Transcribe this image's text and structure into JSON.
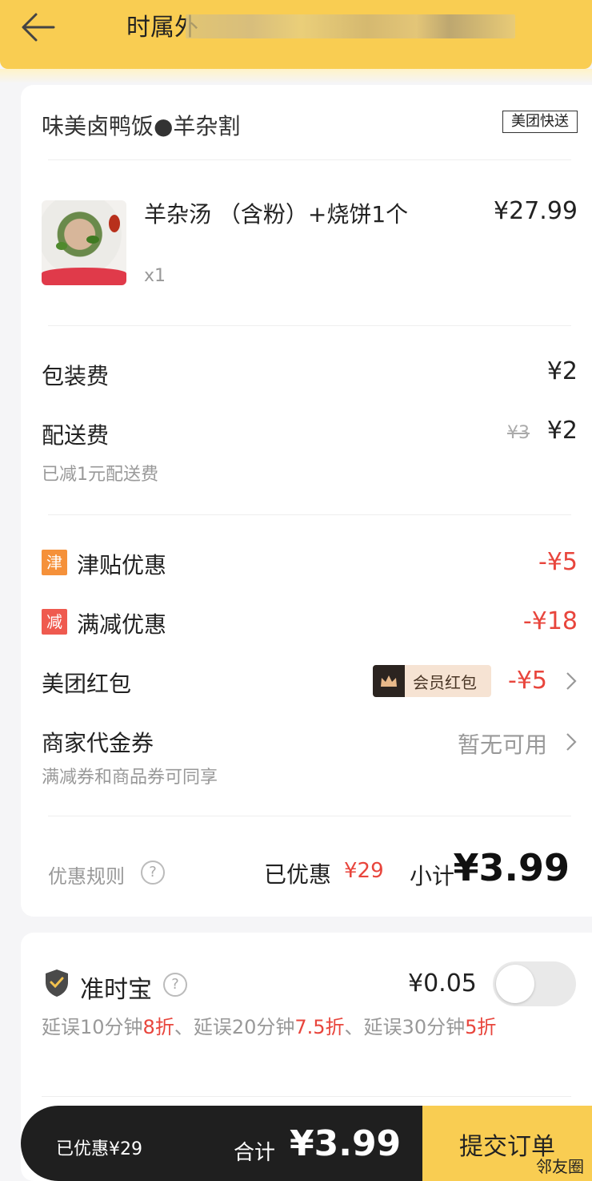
{
  "header": {
    "title": "时属外"
  },
  "order": {
    "shop_name": "味美卤鸭饭●羊杂割",
    "delivery_tag": "美团快送",
    "product": {
      "name": "羊杂汤 （含粉）+烧饼1个",
      "qty": "x1",
      "price": "¥27.99"
    },
    "packing": {
      "label": "包装费",
      "value": "¥2"
    },
    "delivery": {
      "label": "配送费",
      "original": "¥3",
      "value": "¥2",
      "note": "已减1元配送费"
    },
    "subsidy": {
      "badge": "津",
      "label": "津贴优惠",
      "value": "-¥5"
    },
    "discount": {
      "badge": "减",
      "label": "满减优惠",
      "value": "-¥18"
    },
    "redpacket": {
      "label": "美团红包",
      "tag": "会员红包",
      "value": "-¥5"
    },
    "voucher": {
      "label": "商家代金券",
      "sub": "满减券和商品券可同享",
      "value": "暂无可用"
    },
    "summary": {
      "rules_label": "优惠规则",
      "help": "?",
      "saved_label": "已优惠",
      "saved_amount": "¥29",
      "subtotal_label": "小计",
      "subtotal": "¥3.99"
    }
  },
  "insurance": {
    "label": "准时宝",
    "help": "?",
    "price": "¥0.05",
    "toggle_on": false,
    "desc": {
      "p1": "延误10分钟",
      "h1": "8折",
      "p2": "、延误20分钟",
      "h2": "7.5折",
      "p3": "、延误30分钟",
      "h3": "5折"
    },
    "second_label": "护"
  },
  "bottom": {
    "saved": "已优惠¥29",
    "total_label": "合计",
    "total": "¥3.99",
    "submit": "提交订单"
  },
  "watermark": "邻友圈",
  "colors": {
    "header_bg": "#f9cd52",
    "accent_red": "#e8453c",
    "bottom_dark": "#1f1f1f",
    "badge_orange": "#f5913a",
    "badge_red": "#ef5a4f"
  }
}
